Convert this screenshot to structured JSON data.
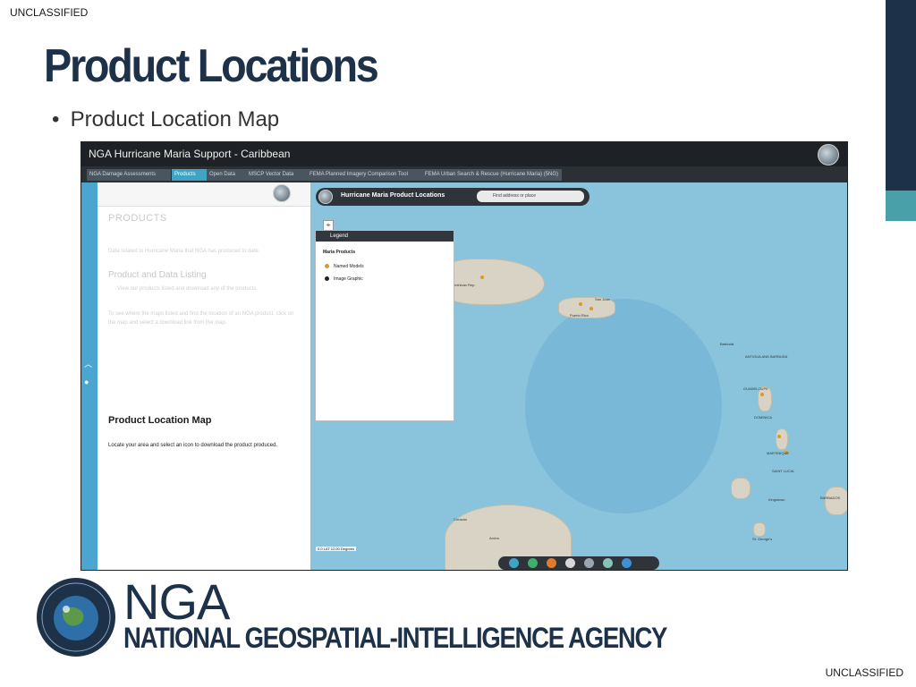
{
  "classification": {
    "top": "UNCLASSIFIED",
    "bottom": "UNCLASSIFIED"
  },
  "slide": {
    "title": "Product Locations",
    "bullet": "Product Location Map"
  },
  "app": {
    "title": "NGA Hurricane Maria Support - Caribbean",
    "tabs": [
      {
        "label": "NGA Damage Assessments",
        "active": false
      },
      {
        "label": "Products",
        "active": true
      },
      {
        "label": "Open Data",
        "active": false
      },
      {
        "label": "MSCP Vector Data",
        "active": false
      },
      {
        "label": "FEMA Planned Imagery Comparison Tool",
        "active": false
      },
      {
        "label": "FEMA Urban Search & Rescue (Hurricane Maria) (5NG)",
        "active": false
      }
    ],
    "left_panel": {
      "heading": "PRODUCTS",
      "intro": "Data related to Hurricane Maria that NGA has produced to date.",
      "subheading": "Product and Data Listing",
      "sub_item": "View our products listed and download any of the products.",
      "faded_paragraph": "To see where the maps listed and find the location of an NGA product, click on the map and select a download link from the map.",
      "section_title": "Product Location Map",
      "section_desc": "Locate your area and select an icon to download the product produced."
    },
    "map": {
      "bar_title": "Hurricane Maria Product Locations",
      "select_value": "Find address or place",
      "legend_title": "Legend",
      "legend_group": "Maria Products",
      "legend_items": [
        "Named Models",
        "Image Graphic"
      ],
      "labels": [
        "Dominican Rep.",
        "Puerto Rico",
        "San Juan",
        "Barbuda",
        "ANTIGUA AND BARBUDA",
        "GUADELOUPE",
        "DOMINICA",
        "MARTINIQUE",
        "SAINT LUCIA",
        "Kingstown",
        "BARBADOS",
        "Curacao",
        "Aruba",
        "St. George's"
      ],
      "scale": "0.0 LAT 12.00 Degrees"
    }
  },
  "logo": {
    "acronym": "NGA",
    "full_name": "NATIONAL GEOSPATIAL-INTELLIGENCE AGENCY",
    "seal_text": "NATIONAL GEOSPATIAL-INTELLIGENCE AGENCY UNITED STATES OF AMERICA"
  },
  "colors": {
    "brand_navy": "#1d3149",
    "accent_teal": "#4aa0a9",
    "app_header": "#1e2226",
    "active_tab": "#3fa3c4",
    "sea": "#8ac4dc",
    "land": "#d8d3c4"
  }
}
